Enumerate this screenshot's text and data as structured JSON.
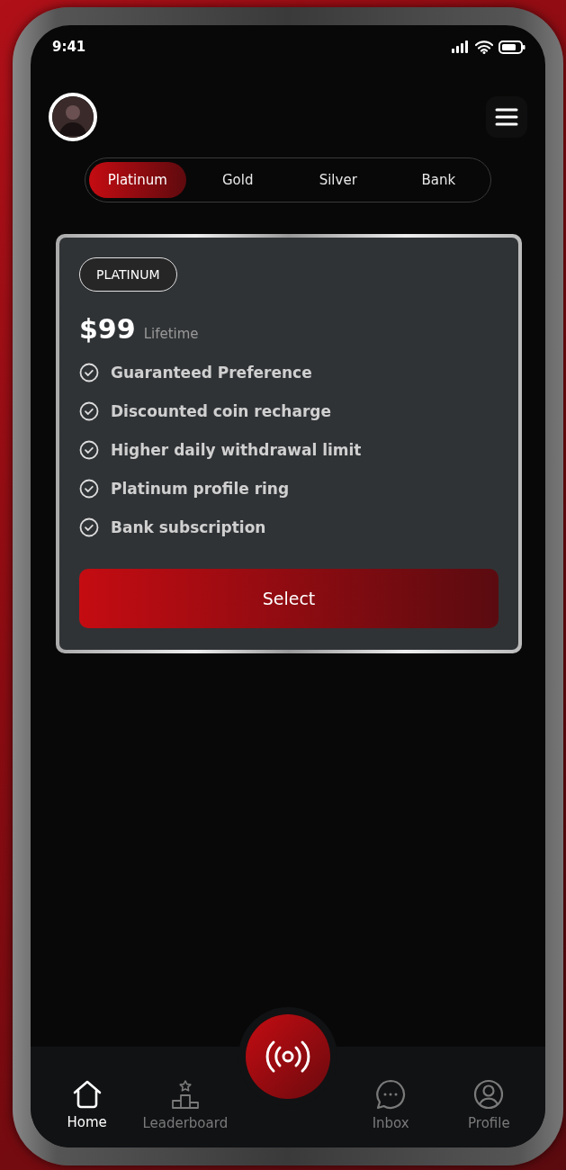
{
  "status_bar": {
    "time": "9:41"
  },
  "tabs": [
    {
      "label": "Platinum",
      "selected": true
    },
    {
      "label": "Gold",
      "selected": false
    },
    {
      "label": "Silver",
      "selected": false
    },
    {
      "label": "Bank",
      "selected": false
    }
  ],
  "plan": {
    "badge": "PLATINUM",
    "price": "$99",
    "period": "Lifetime",
    "features": [
      "Guaranteed Preference",
      "Discounted coin recharge",
      "Higher daily withdrawal limit",
      "Platinum profile ring",
      "Bank subscription"
    ],
    "button": "Select"
  },
  "nav": [
    {
      "kind": "home",
      "label": "Home",
      "selected": true
    },
    {
      "kind": "leaderboard",
      "label": "Leaderboard",
      "selected": false
    },
    {
      "kind": "live",
      "selected": false
    },
    {
      "kind": "inbox",
      "label": "Inbox",
      "selected": false
    },
    {
      "kind": "profile",
      "label": "Profile",
      "selected": false
    }
  ]
}
